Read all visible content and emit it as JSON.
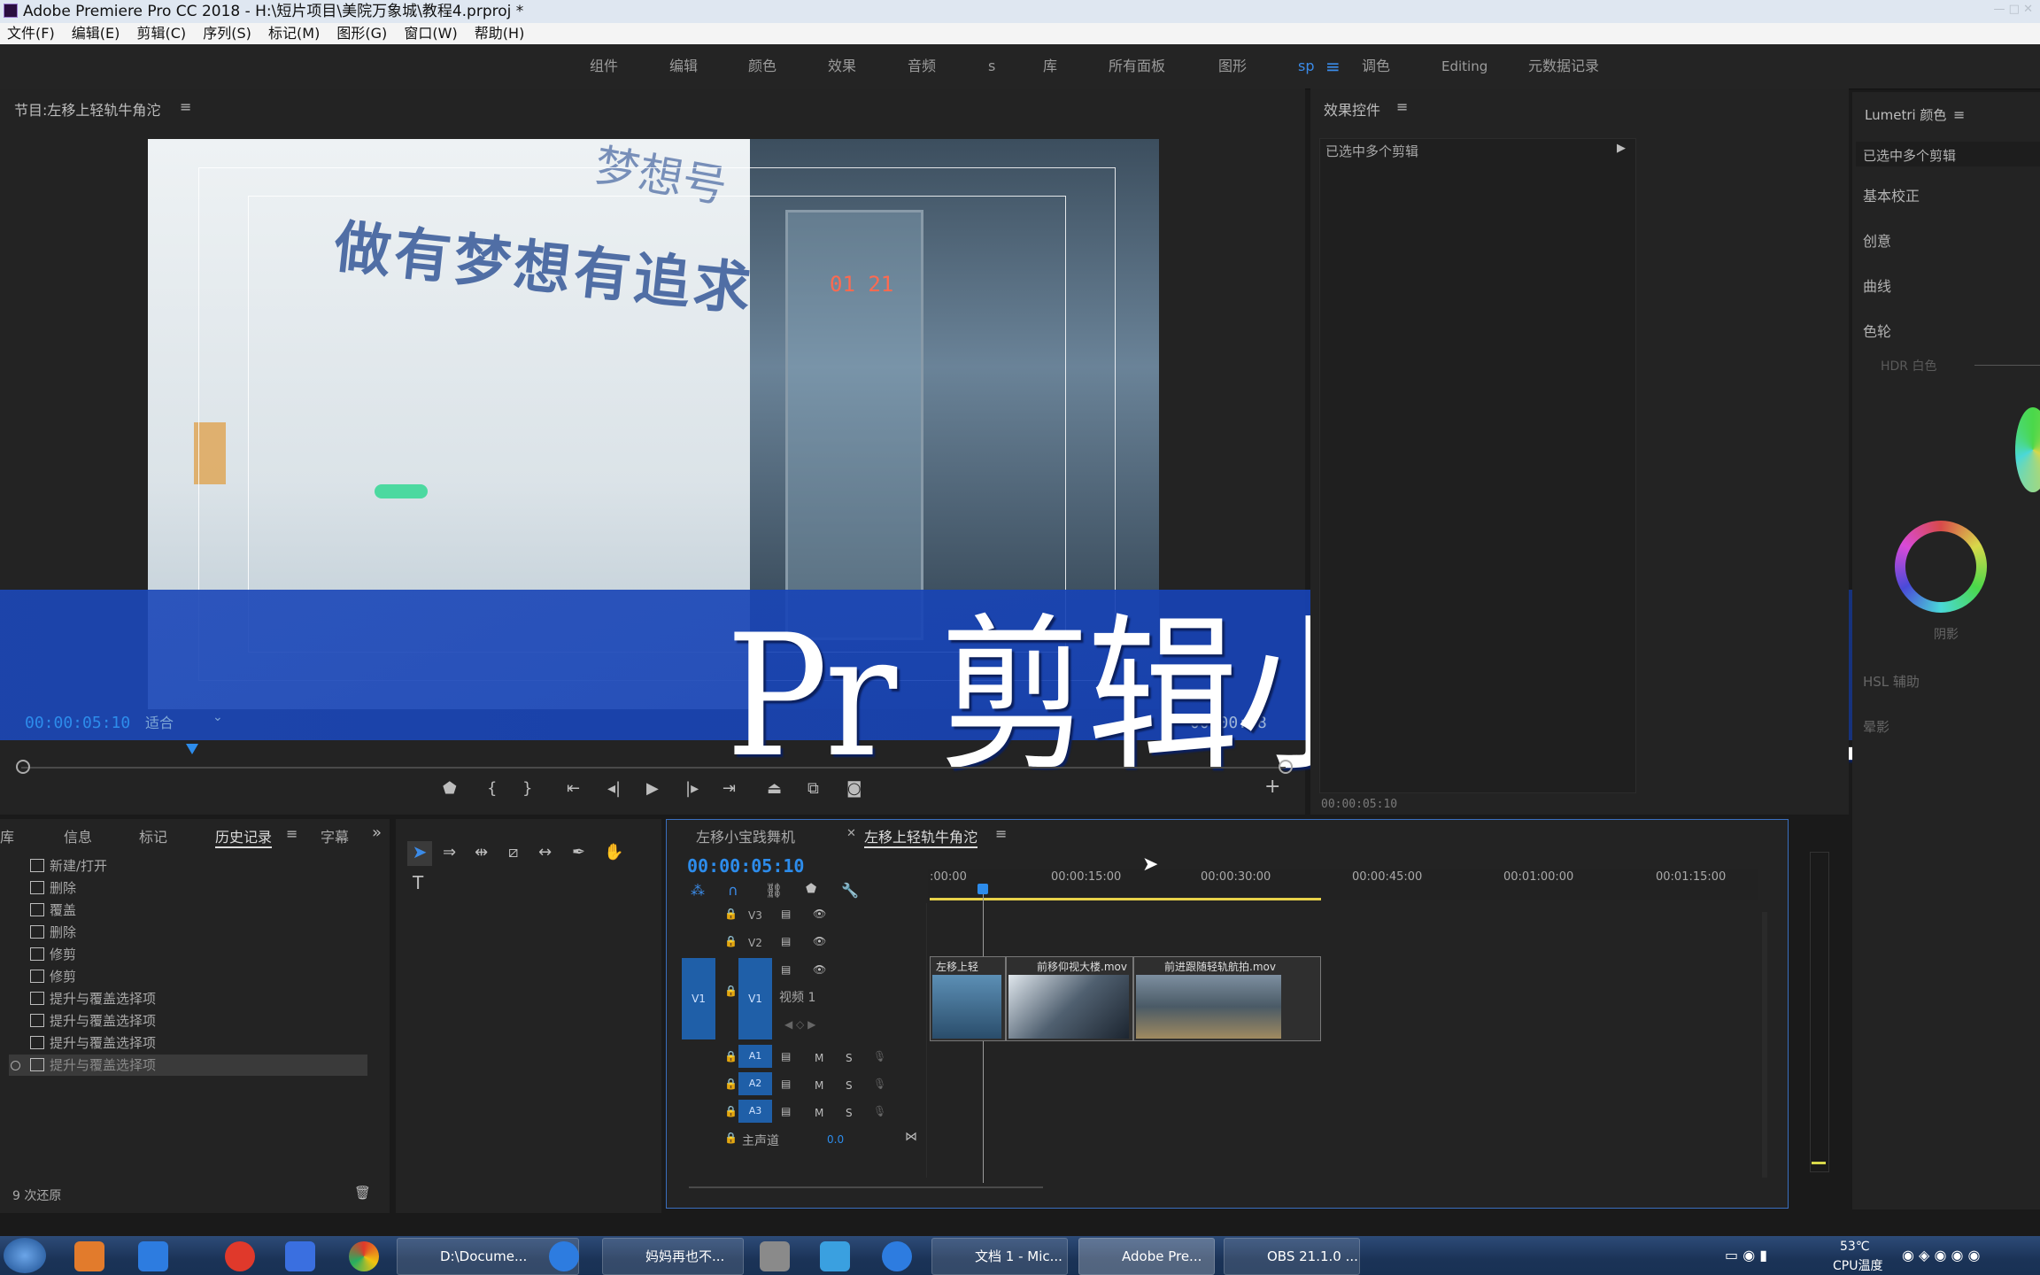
{
  "window": {
    "title": "Adobe Premiere Pro CC 2018 - H:\\短片项目\\美院万象城\\教程4.prproj *",
    "controls": "— □ ✕"
  },
  "menu": [
    "文件(F)",
    "编辑(E)",
    "剪辑(C)",
    "序列(S)",
    "标记(M)",
    "图形(G)",
    "窗口(W)",
    "帮助(H)"
  ],
  "workspaces": [
    "组件",
    "编辑",
    "颜色",
    "效果",
    "音频",
    "s",
    "库",
    "所有面板",
    "图形",
    "sp",
    "调色",
    "Editing",
    "元数据记录"
  ],
  "active_workspace": "sp",
  "program": {
    "title": "节目:左移上轻轨牛角沱",
    "timecode": "00:00:05:10",
    "fit": "适合",
    "fit_arrow": "⌄",
    "right_tc": "00:00:18",
    "poster_top": "梦想号",
    "poster_text": "做有梦想有追求",
    "led": "01 21"
  },
  "overlay_title": "Pr 剪辑小技巧（上）",
  "effects": {
    "title": "效果控件",
    "selection": "已选中多个剪辑",
    "timecode": "00:00:05:10"
  },
  "lumetri": {
    "title": "Lumetri 颜色",
    "selection": "已选中多个剪辑",
    "sections": [
      "基本校正",
      "创意",
      "曲线",
      "色轮"
    ],
    "hdr": "HDR 白色",
    "shadow": "阴影",
    "hsl": "HSL 辅助",
    "vignette": "晕影"
  },
  "history": {
    "tabs": [
      "库",
      "信息",
      "标记",
      "历史记录",
      "字幕"
    ],
    "active_tab": "历史记录",
    "items": [
      "新建/打开",
      "删除",
      "覆盖",
      "删除",
      "修剪",
      "修剪",
      "提升与覆盖选择项",
      "提升与覆盖选择项",
      "提升与覆盖选择项",
      "提升与覆盖选择项"
    ],
    "undo_count": "9 次还原"
  },
  "timeline": {
    "tabs": [
      "左移小宝践舞机",
      "左移上轻轨牛角沱"
    ],
    "timecode": "00:00:05:10",
    "ruler": [
      ":00:00",
      "00:00:15:00",
      "00:00:30:00",
      "00:00:45:00",
      "00:01:00:00",
      "00:01:15:00"
    ],
    "video_tracks": [
      "V3",
      "V2",
      "V1"
    ],
    "video_track_name": "视频 1",
    "audio_tracks": [
      "A1",
      "A2",
      "A3"
    ],
    "master": "主声道",
    "master_value": "0.0",
    "clips": [
      "左移上轻",
      "前移仰视大楼.mov",
      "前进跟随轻轨航拍.mov"
    ],
    "mute": "M",
    "solo": "S"
  },
  "taskbar": {
    "items": [
      "D:\\Docume...",
      "妈妈再也不...",
      "文档 1 - Mic...",
      "Adobe Pre...",
      "OBS 21.1.0 ..."
    ],
    "temp": "53℃",
    "temp_label": "CPU温度"
  },
  "colors": {
    "accent": "#3b8be8",
    "timecode": "#2d8ceb",
    "banner": "#1c48b9",
    "track_blue": "#1f5fa8"
  }
}
